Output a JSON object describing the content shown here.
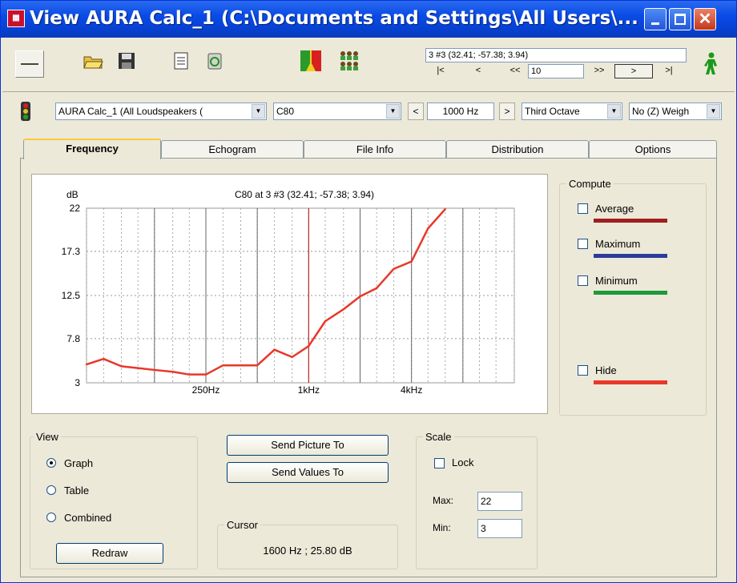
{
  "window": {
    "title": "View AURA Calc_1 (C:\\Documents and Settings\\All Users\\..."
  },
  "toolbar": {
    "position_text": "3 #3  (32.41; -57.38; 3.94)",
    "nav_first": "|<",
    "nav_prev": "<",
    "nav_back_step": "<<",
    "nav_step_value": "10",
    "nav_fwd_step": ">>",
    "nav_next": ">",
    "nav_last": ">|"
  },
  "selectors": {
    "calc": "AURA Calc_1 (All Loudspeakers (",
    "parameter": "C80",
    "freq_down": "<",
    "frequency": "1000 Hz",
    "freq_up": ">",
    "band": "Third Octave",
    "weighting": "No (Z) Weigh"
  },
  "tabs": [
    "Frequency",
    "Echogram",
    "File Info",
    "Distribution",
    "Options"
  ],
  "chart_data": {
    "type": "line",
    "title": "C80 at 3 #3  (32.41; -57.38; 3.94)",
    "ylabel": "dB",
    "yticks": [
      "22",
      "17.3",
      "12.5",
      "7.8",
      "3"
    ],
    "ylim": [
      3,
      22
    ],
    "xticks": [
      "250Hz",
      "1kHz",
      "4kHz"
    ],
    "x_scale": "log (third-octave bands)",
    "x": [
      50,
      63,
      80,
      100,
      125,
      160,
      200,
      250,
      315,
      400,
      500,
      630,
      800,
      1000,
      1250,
      1600,
      2000,
      2500,
      3150,
      4000,
      5000,
      6300,
      8000,
      10000,
      12500,
      16000
    ],
    "series": [
      {
        "values": [
          5.0,
          5.6,
          4.8,
          4.6,
          4.4,
          4.2,
          3.9,
          3.9,
          4.9,
          4.9,
          4.9,
          6.6,
          5.8,
          7.0,
          9.7,
          11.0,
          12.4,
          13.3,
          15.4,
          16.2,
          19.8,
          21.9
        ]
      }
    ],
    "cursor_x": 1000,
    "grid": true
  },
  "compute": {
    "title": "Compute",
    "items": [
      {
        "label": "Average",
        "color": "#a01e1e"
      },
      {
        "label": "Maximum",
        "color": "#2a3c9a"
      },
      {
        "label": "Minimum",
        "color": "#1e9a3c"
      },
      {
        "label": "Hide",
        "color": "#e8382a"
      }
    ]
  },
  "view": {
    "title": "View",
    "options": [
      "Graph",
      "Table",
      "Combined"
    ],
    "selected": "Graph",
    "redraw": "Redraw"
  },
  "actions": {
    "send_picture": "Send Picture To",
    "send_values": "Send Values To"
  },
  "cursor": {
    "title": "Cursor",
    "value": "1600 Hz ; 25.80 dB"
  },
  "scale": {
    "title": "Scale",
    "lock": "Lock",
    "max_label": "Max:",
    "max_value": "22",
    "min_label": "Min:",
    "min_value": "3"
  }
}
